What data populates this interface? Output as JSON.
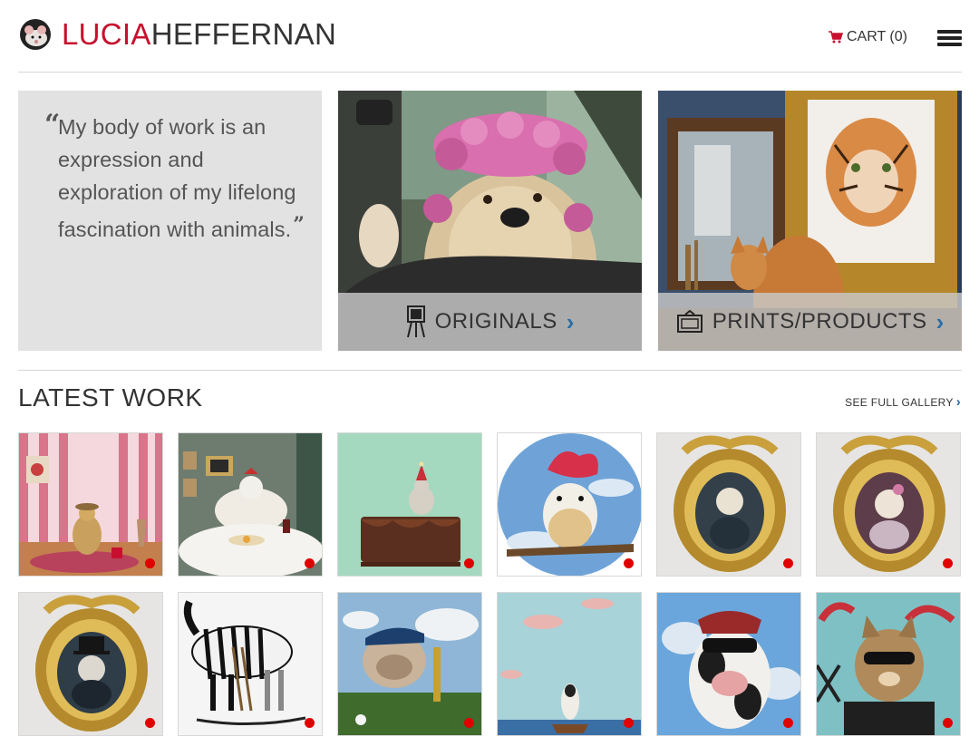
{
  "brand": {
    "first": "LUCIA",
    "last": "HEFFERNAN",
    "accent": "#c8102e",
    "icon": "mouse-mascot-icon"
  },
  "header": {
    "cart_label": "CART (0)",
    "cart_icon": "cart-icon",
    "menu_icon": "hamburger-icon"
  },
  "quote": {
    "text": "My body of work is an expression and exploration of my lifelong fascination with animals."
  },
  "hero": {
    "originals": {
      "label": "ORIGINALS",
      "icon": "easel-icon"
    },
    "prints": {
      "label": "PRINTS/PRODUCTS",
      "icon": "frame-icon"
    }
  },
  "latest": {
    "title": "LATEST WORK",
    "gallery_link": "SEE FULL GALLERY"
  },
  "artworks": [
    {
      "subject": "duck-in-pink-room"
    },
    {
      "subject": "rooster-at-dinner"
    },
    {
      "subject": "bird-on-cake"
    },
    {
      "subject": "bird-with-hibiscus-hat"
    },
    {
      "subject": "portrait-in-gold-frame-1"
    },
    {
      "subject": "portrait-in-gold-frame-2"
    },
    {
      "subject": "portrait-in-gold-frame-3"
    },
    {
      "subject": "zebra-painters"
    },
    {
      "subject": "bulldog-golfer"
    },
    {
      "subject": "cow-at-sea"
    },
    {
      "subject": "cow-with-sunglasses"
    },
    {
      "subject": "cat-with-sunglasses"
    }
  ]
}
